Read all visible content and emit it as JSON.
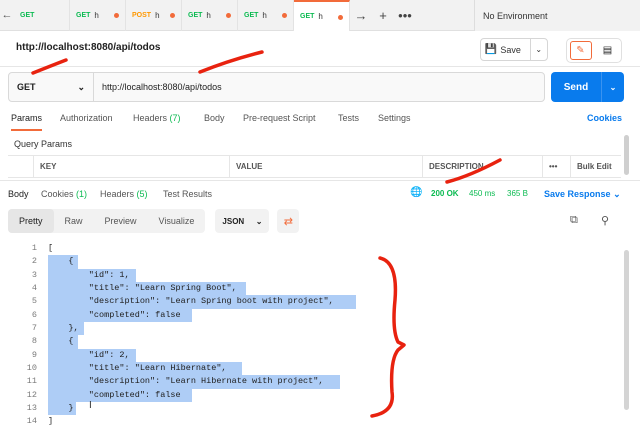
{
  "tabs": [
    {
      "method": "GET",
      "title": "",
      "method_color": "#0cbb52"
    },
    {
      "method": "GET",
      "title": "h",
      "method_color": "#0cbb52"
    },
    {
      "method": "POST",
      "title": "h",
      "method_color": "#ff9800"
    },
    {
      "method": "GET",
      "title": "h",
      "method_color": "#0cbb52"
    },
    {
      "method": "GET",
      "title": "h",
      "method_color": "#0cbb52"
    },
    {
      "method": "GET",
      "title": "h",
      "method_color": "#0cbb52"
    }
  ],
  "environment": "No Environment",
  "request": {
    "title": "http://localhost:8080/api/todos",
    "method": "GET",
    "url": "http://localhost:8080/api/todos",
    "save_label": "Save",
    "send_label": "Send"
  },
  "request_tabs": {
    "params": "Params",
    "authorization": "Authorization",
    "headers": "Headers",
    "headers_count": "(7)",
    "body": "Body",
    "prerequest": "Pre-request Script",
    "tests": "Tests",
    "settings": "Settings",
    "cookies": "Cookies"
  },
  "query_params": {
    "title": "Query Params",
    "columns": [
      "KEY",
      "VALUE",
      "DESCRIPTION",
      "•••",
      "Bulk Edit"
    ]
  },
  "response": {
    "tabs": {
      "body": "Body",
      "cookies": "Cookies",
      "cookies_count": "(1)",
      "headers": "Headers",
      "headers_count": "(5)",
      "test_results": "Test Results"
    },
    "status": "200 OK",
    "time": "450 ms",
    "size": "365 B",
    "save_response": "Save Response",
    "view_modes": [
      "Pretty",
      "Raw",
      "Preview",
      "Visualize"
    ],
    "format": "JSON"
  },
  "code_lines": [
    "[",
    "    {",
    "        \"id\": 1,",
    "        \"title\": \"Learn Spring Boot\",",
    "        \"description\": \"Learn Spring boot with project\",",
    "        \"completed\": false",
    "    },",
    "    {",
    "        \"id\": 2,",
    "        \"title\": \"Learn Hibernate\",",
    "        \"description\": \"Learn Hibernate with project\",",
    "        \"completed\": false",
    "    }",
    "]"
  ],
  "colors": {
    "accent": "#f26b3a",
    "primary": "#097bed",
    "success": "#0cbb52",
    "selection": "#aecdf6",
    "annotation": "#e8220f"
  }
}
